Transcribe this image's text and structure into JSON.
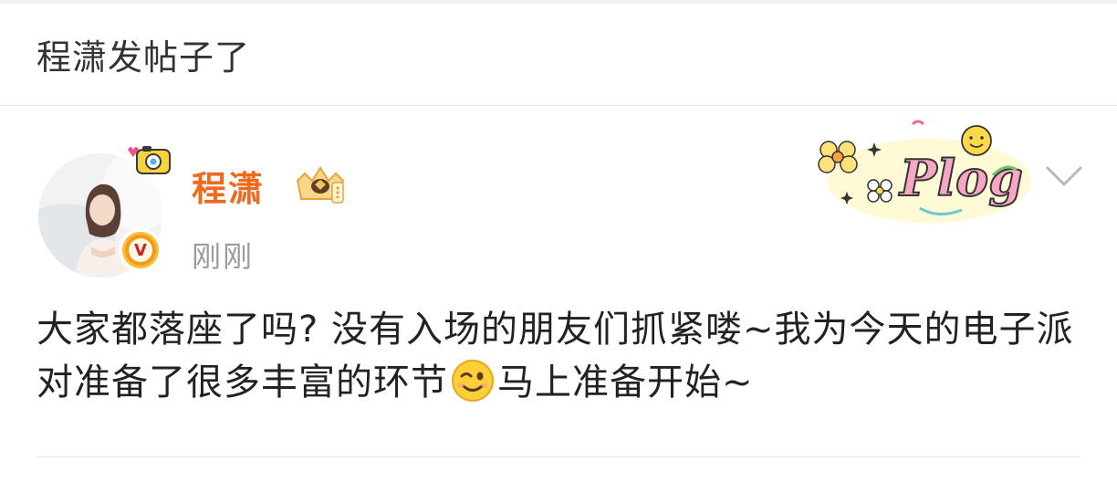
{
  "header": {
    "title": "程潇发帖子了"
  },
  "post": {
    "author": {
      "name": "程潇",
      "verified_letter": "V"
    },
    "timestamp": "刚刚",
    "text_part1": "大家都落座了吗? 没有入场的朋友们抓紧喽~我为今天的电子派对准备了很多丰富的环节",
    "emoji_name": "wink-emoji",
    "text_part2": "马上准备开始~",
    "sticker_text": "Plog"
  },
  "colors": {
    "username": "#f06a1e",
    "timestamp": "#9a9a9a",
    "text": "#222222",
    "verified_badge": "#f59a12"
  }
}
